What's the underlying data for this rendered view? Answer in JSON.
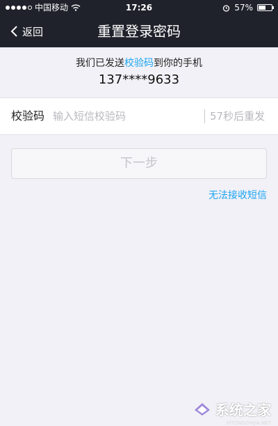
{
  "status_bar": {
    "carrier": "中国移动",
    "time": "17:26",
    "battery_percent": "57%",
    "battery_level": 0.57,
    "icons": [
      "signal-dots-icon",
      "wifi-icon",
      "alarm-icon",
      "battery-icon"
    ]
  },
  "nav": {
    "back_label": "返回",
    "title": "重置登录密码"
  },
  "info": {
    "msg_prefix": "我们已发送",
    "msg_highlight": "校验码",
    "msg_suffix": "到你的手机",
    "phone": "137****9633"
  },
  "code_field": {
    "label": "校验码",
    "placeholder": "输入短信校验码",
    "resend_text": "57秒后重发"
  },
  "next_button": {
    "label": "下一步"
  },
  "cannot_receive_link": "无法接收短信",
  "watermark": {
    "text": "系统之家",
    "url": "XITONGZHIJIA.NET"
  },
  "colors": {
    "header_bg": "#1f222b",
    "page_bg": "#f2f1f7",
    "accent": "#1ca5f2",
    "disabled_text": "#c4c4ca"
  }
}
